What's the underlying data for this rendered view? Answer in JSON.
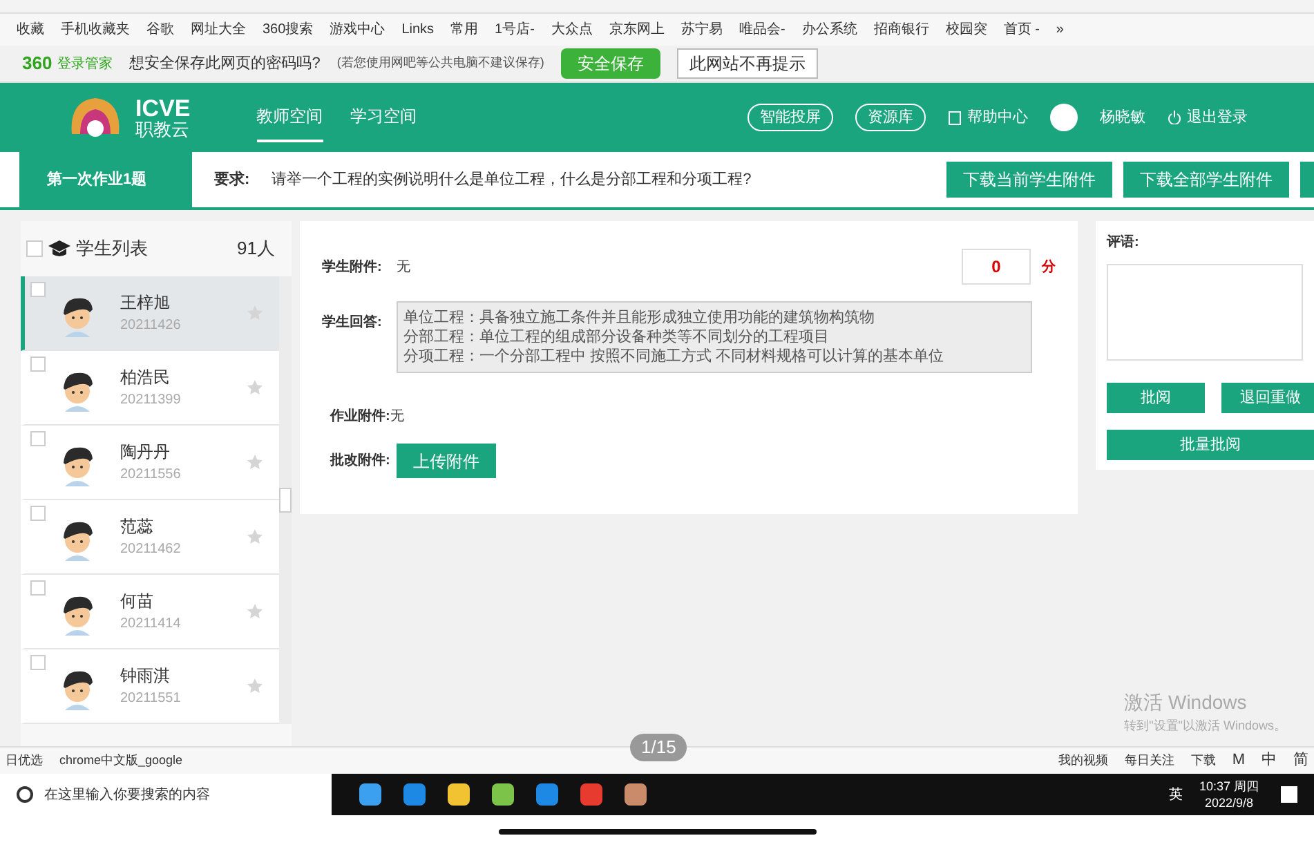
{
  "bookmarks": [
    {
      "label": "收藏"
    },
    {
      "label": "手机收藏夹"
    },
    {
      "label": "谷歌"
    },
    {
      "label": "网址大全"
    },
    {
      "label": "360搜索"
    },
    {
      "label": "游戏中心"
    },
    {
      "label": "Links"
    },
    {
      "label": "常用"
    },
    {
      "label": "1号店-"
    },
    {
      "label": "大众点"
    },
    {
      "label": "京东网上"
    },
    {
      "label": "苏宁易"
    },
    {
      "label": "唯品会-"
    },
    {
      "label": "办公系统"
    },
    {
      "label": "招商银行"
    },
    {
      "label": "校园突"
    },
    {
      "label": "首页 -"
    }
  ],
  "bookmarks_more": "»",
  "password_bar": {
    "brand": "360",
    "brand_sub": "登录管家",
    "question": "想安全保存此网页的密码吗?",
    "hint": "(若您使用网吧等公共电脑不建议保存)",
    "save": "安全保存",
    "never": "此网站不再提示"
  },
  "header": {
    "logo": "ICVE",
    "logo_sub": "职教云",
    "nav": [
      {
        "label": "教师空间",
        "selected": true
      },
      {
        "label": "学习空间",
        "selected": false
      }
    ],
    "pills": [
      "智能投屏",
      "资源库"
    ],
    "help": "帮助中心",
    "user": "杨晓敏",
    "logout": "退出登录"
  },
  "task_bar": {
    "title": "第一次作业1题",
    "requirement_label": "要求:",
    "requirement": "请举一个工程的实例说明什么是单位工程，什么是分部工程和分项工程?",
    "buttons": [
      "下载当前学生附件",
      "下载全部学生附件"
    ]
  },
  "student_list": {
    "title": "学生列表",
    "count": "91人",
    "checked": false,
    "students": [
      {
        "name": "王梓旭",
        "id": "20211426",
        "selected": true,
        "checked": false
      },
      {
        "name": "柏浩民",
        "id": "20211399",
        "selected": false,
        "checked": false
      },
      {
        "name": "陶丹丹",
        "id": "20211556",
        "selected": false,
        "checked": false
      },
      {
        "name": "范蕊",
        "id": "20211462",
        "selected": false,
        "checked": false
      },
      {
        "name": "何苗",
        "id": "20211414",
        "selected": false,
        "checked": false
      },
      {
        "name": "钟雨淇",
        "id": "20211551",
        "selected": false,
        "checked": false
      }
    ]
  },
  "review": {
    "student_attachment_label": "学生附件:",
    "student_attachment": "无",
    "score": "0",
    "score_unit": "分",
    "answer_label": "学生回答:",
    "answer": [
      "单位工程：具备独立施工条件并且能形成独立使用功能的建筑物构筑物",
      "分部工程：单位工程的组成部分设备种类等不同划分的工程项目",
      "分项工程：一个分部工程中 按照不同施工方式 不同材料规格可以计算的基本单位"
    ],
    "homework_attachment_label": "作业附件:",
    "homework_attachment": "无",
    "correction_label": "批改附件:",
    "upload": "上传附件"
  },
  "comment_panel": {
    "label": "评语:",
    "buttons": [
      "批阅",
      "退回重做"
    ],
    "batch": "批量批阅"
  },
  "activation": {
    "title": "激活 Windows",
    "text": "转到\"设置\"以激活 Windows。"
  },
  "page_counter": "1/15",
  "status_bar": {
    "left": "日优选",
    "tab": "chrome中文版_google",
    "items": [
      "我的视频",
      "每日关注",
      "下载"
    ],
    "ime": [
      "M",
      "中",
      "简"
    ]
  },
  "taskbar": {
    "search": "在这里输入你要搜索的内容",
    "lang": "英",
    "time": "10:37 周四",
    "date": "2022/9/8"
  }
}
